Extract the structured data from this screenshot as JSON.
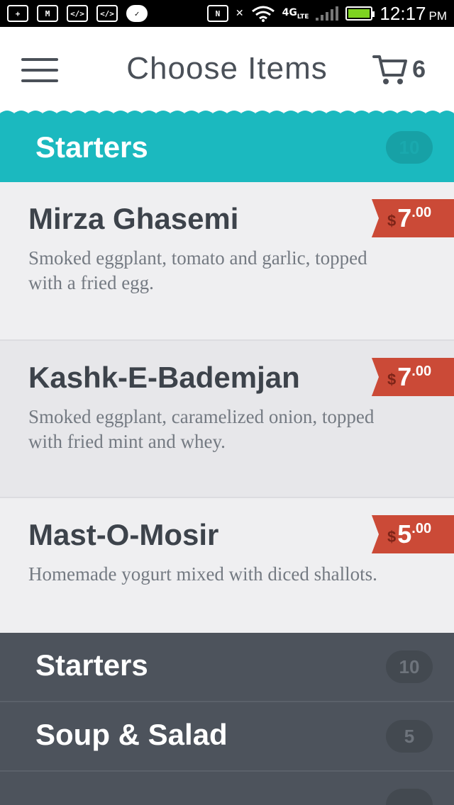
{
  "status_bar": {
    "icons": [
      "add-icon",
      "gmail-icon",
      "code-icon",
      "code-icon",
      "check-icon",
      "nfc-icon",
      "muted-icon",
      "wifi-icon",
      "signal-icon",
      "battery-icon"
    ],
    "network": "4G",
    "network_sub": "LTE",
    "time": "12:17",
    "ampm": "PM"
  },
  "header": {
    "title": "Choose Items",
    "cart_count": "6"
  },
  "active_category": {
    "label": "Starters",
    "count": "10"
  },
  "items": [
    {
      "name": "Mirza Ghasemi",
      "description": "Smoked eggplant, tomato and garlic, topped with a fried egg.",
      "currency": "$",
      "price_whole": "7",
      "price_cents": ".00"
    },
    {
      "name": "Kashk-E-Bademjan",
      "description": "Smoked eggplant, caramelized onion, topped with fried mint and whey.",
      "currency": "$",
      "price_whole": "7",
      "price_cents": ".00"
    },
    {
      "name": "Mast-O-Mosir",
      "description": "Homemade yogurt mixed with diced shallots.",
      "currency": "$",
      "price_whole": "5",
      "price_cents": ".00"
    }
  ],
  "categories": [
    {
      "label": "Starters",
      "count": "10"
    },
    {
      "label": "Soup & Salad",
      "count": "5"
    }
  ],
  "colors": {
    "teal": "#1bb9bf",
    "price_red": "#cb4a37",
    "dark_panel": "#4d535c",
    "text_dark": "#3d434b"
  }
}
